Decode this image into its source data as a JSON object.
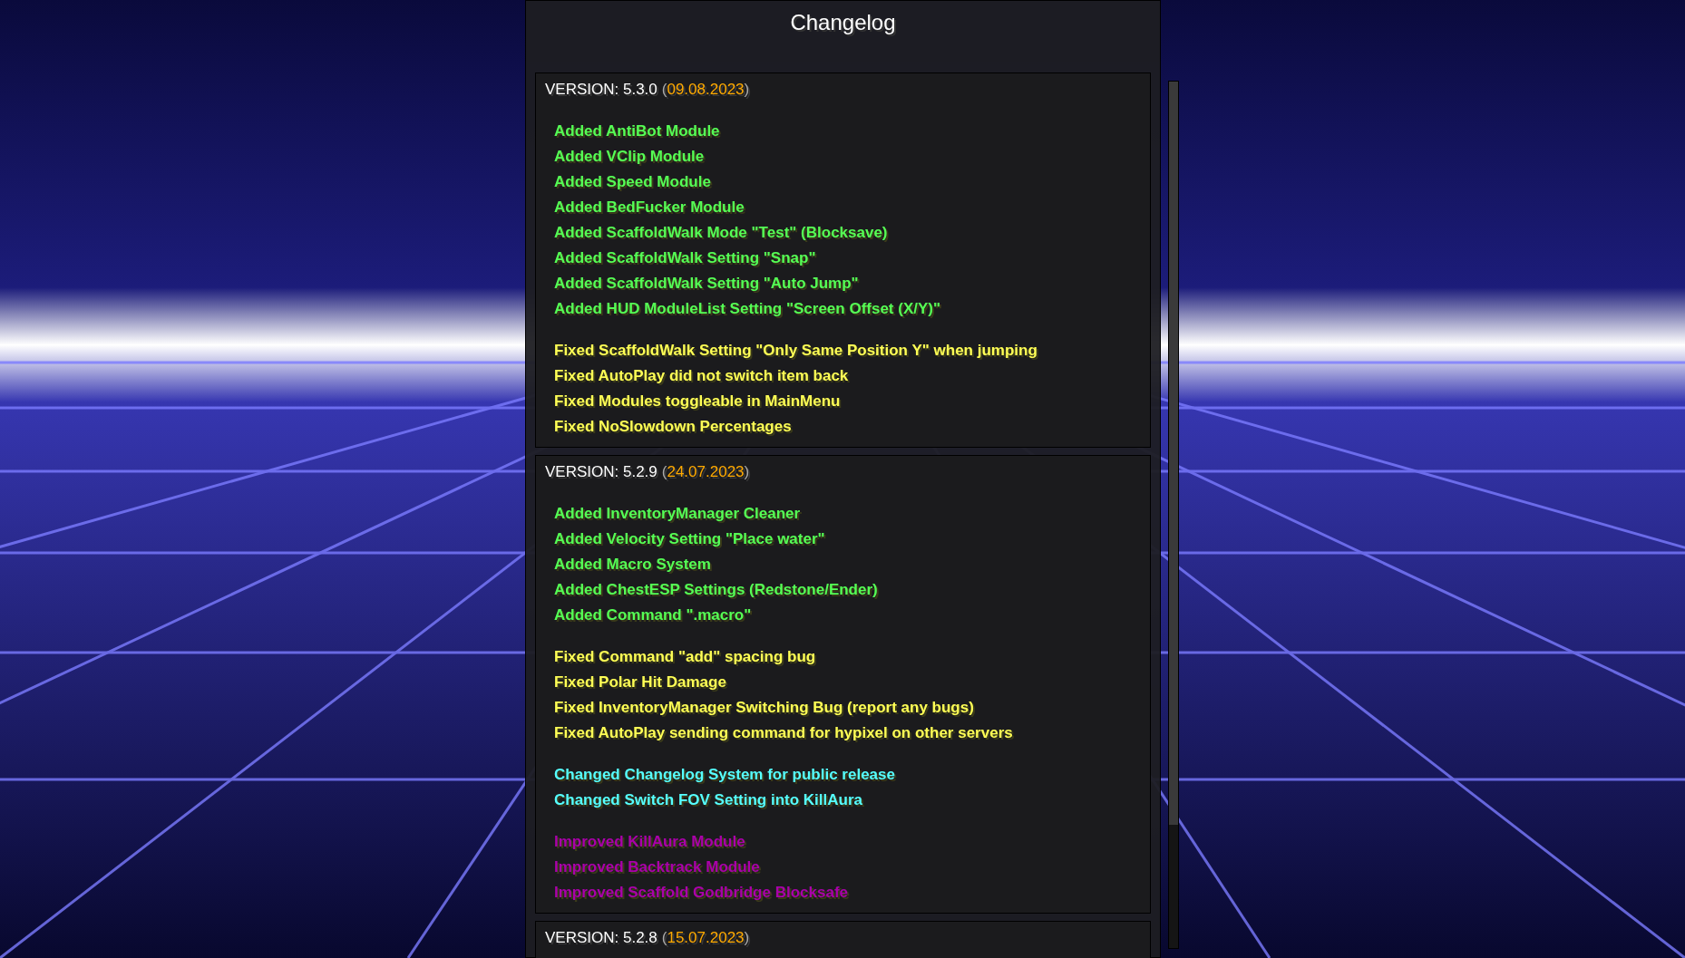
{
  "title": "Changelog",
  "versions": [
    {
      "label": "VERSION: 5.3.0",
      "open": "(",
      "date": "09.08.2023",
      "close": ")",
      "groups": [
        {
          "kind": "added",
          "items": [
            "Added AntiBot Module",
            "Added VClip Module",
            "Added Speed Module",
            "Added BedFucker Module",
            "Added ScaffoldWalk Mode \"Test\" (Blocksave)",
            "Added ScaffoldWalk Setting \"Snap\"",
            "Added ScaffoldWalk Setting \"Auto Jump\"",
            "Added HUD ModuleList Setting \"Screen Offset (X/Y)\""
          ]
        },
        {
          "kind": "fixed",
          "items": [
            "Fixed ScaffoldWalk Setting \"Only Same Position Y\" when jumping",
            "Fixed AutoPlay did not switch item back",
            "Fixed Modules toggleable in MainMenu",
            "Fixed NoSlowdown Percentages"
          ]
        }
      ]
    },
    {
      "label": "VERSION: 5.2.9",
      "open": "(",
      "date": "24.07.2023",
      "close": ")",
      "groups": [
        {
          "kind": "added",
          "items": [
            "Added InventoryManager Cleaner",
            "Added Velocity Setting \"Place water\"",
            "Added Macro System",
            "Added ChestESP Settings (Redstone/Ender)",
            "Added Command \".macro\""
          ]
        },
        {
          "kind": "fixed",
          "items": [
            "Fixed Command \"add\" spacing bug",
            "Fixed Polar Hit Damage",
            "Fixed InventoryManager Switching Bug (report any bugs)",
            "Fixed AutoPlay sending command for hypixel on other servers"
          ]
        },
        {
          "kind": "changed",
          "items": [
            "Changed Changelog System for public release",
            "Changed Switch FOV Setting into KillAura"
          ]
        },
        {
          "kind": "improved",
          "items": [
            "Improved KillAura Module",
            "Improved Backtrack Module",
            "Improved Scaffold Godbridge Blocksafe"
          ]
        }
      ]
    },
    {
      "label": "VERSION: 5.2.8",
      "open": "(",
      "date": "15.07.2023",
      "close": ")"
    }
  ]
}
